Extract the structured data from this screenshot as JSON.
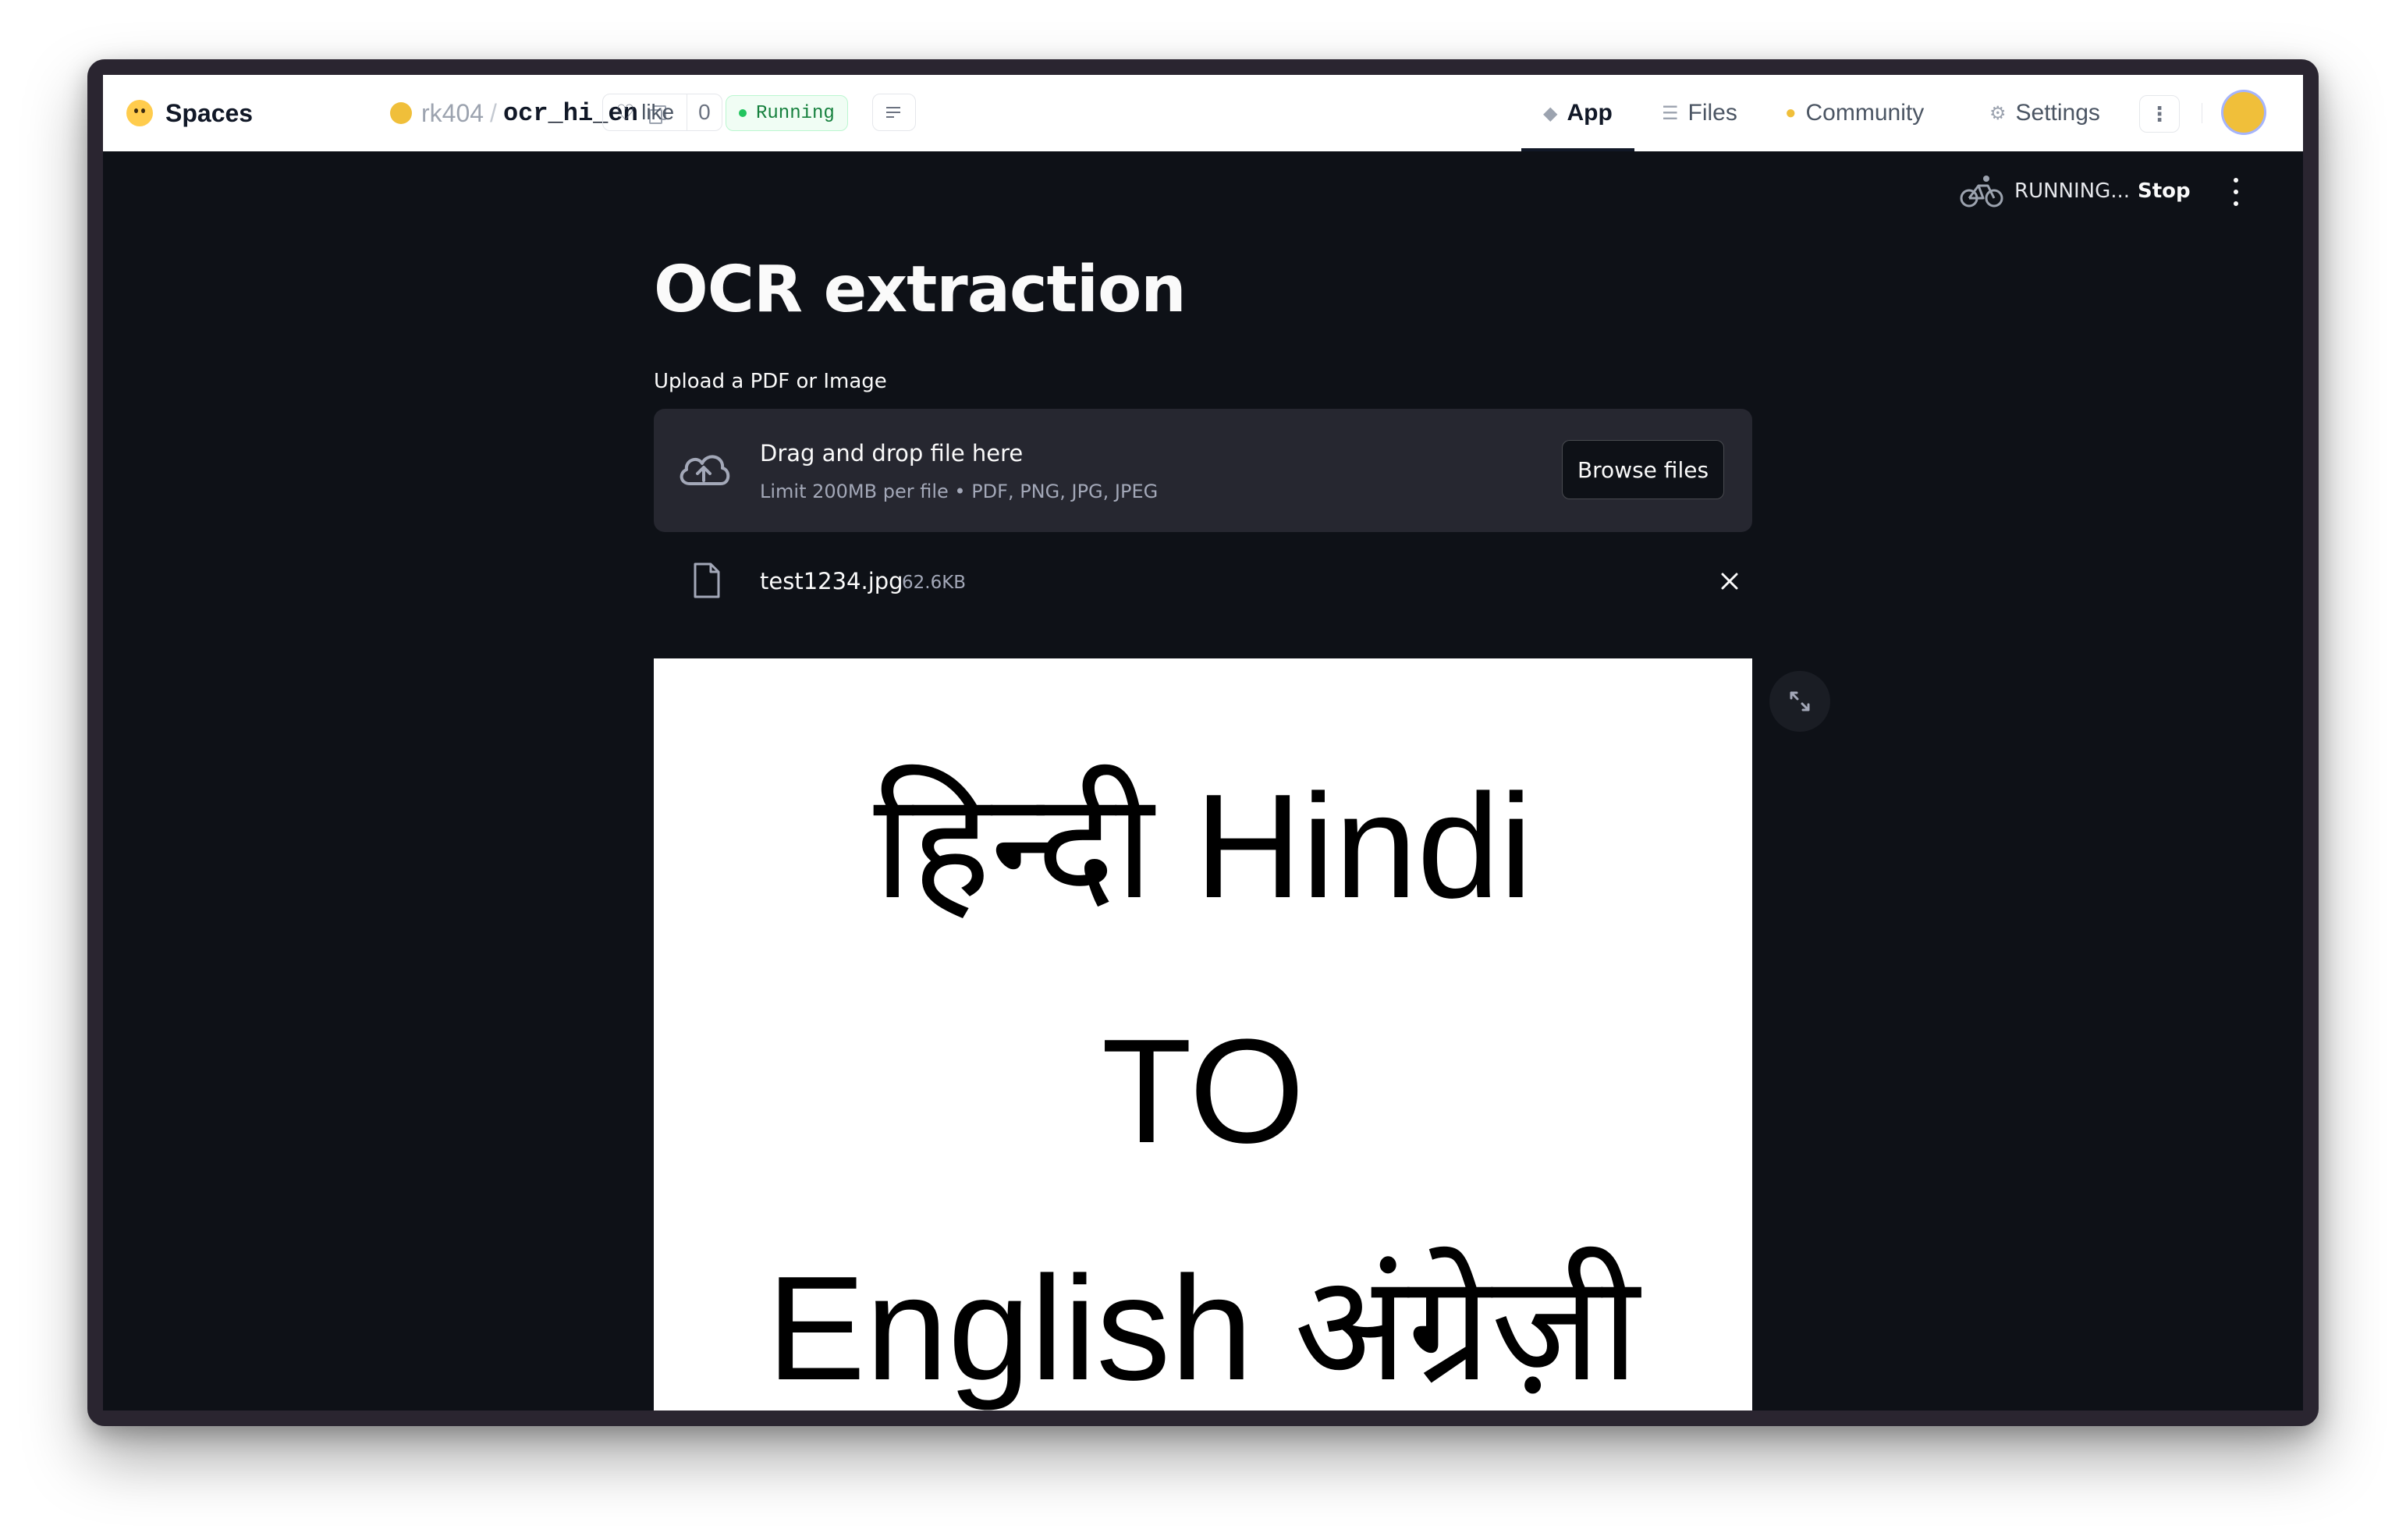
{
  "header": {
    "brand": "Spaces",
    "owner": "rk404",
    "repo": "ocr_hi_en",
    "like_label": "like",
    "like_count": "0",
    "status": "Running",
    "tabs": [
      {
        "label": "App",
        "icon": "cube-icon",
        "active": true
      },
      {
        "label": "Files",
        "icon": "files-icon",
        "active": false
      },
      {
        "label": "Community",
        "icon": "community-icon",
        "active": false
      },
      {
        "label": "Settings",
        "icon": "gear-icon",
        "active": false
      }
    ]
  },
  "app": {
    "running_label": "RUNNING...",
    "stop_label": "Stop",
    "title": "OCR extraction",
    "upload_label": "Upload a PDF or Image",
    "dropzone": {
      "title": "Drag and drop file here",
      "limit": "Limit 200MB per file • PDF, PNG, JPG, JPEG",
      "browse_label": "Browse files"
    },
    "uploaded_file": {
      "name": "test1234.jpg",
      "size": "62.6KB"
    },
    "image_text": {
      "line1": "हिन्दी  Hindi",
      "line2": "TO",
      "line3": "English  अंग्रेज़ी"
    }
  },
  "colors": {
    "app_bg": "#0e1117",
    "dropzone_bg": "#262730",
    "status_green": "#22c55e",
    "text_light": "#fafafa"
  }
}
